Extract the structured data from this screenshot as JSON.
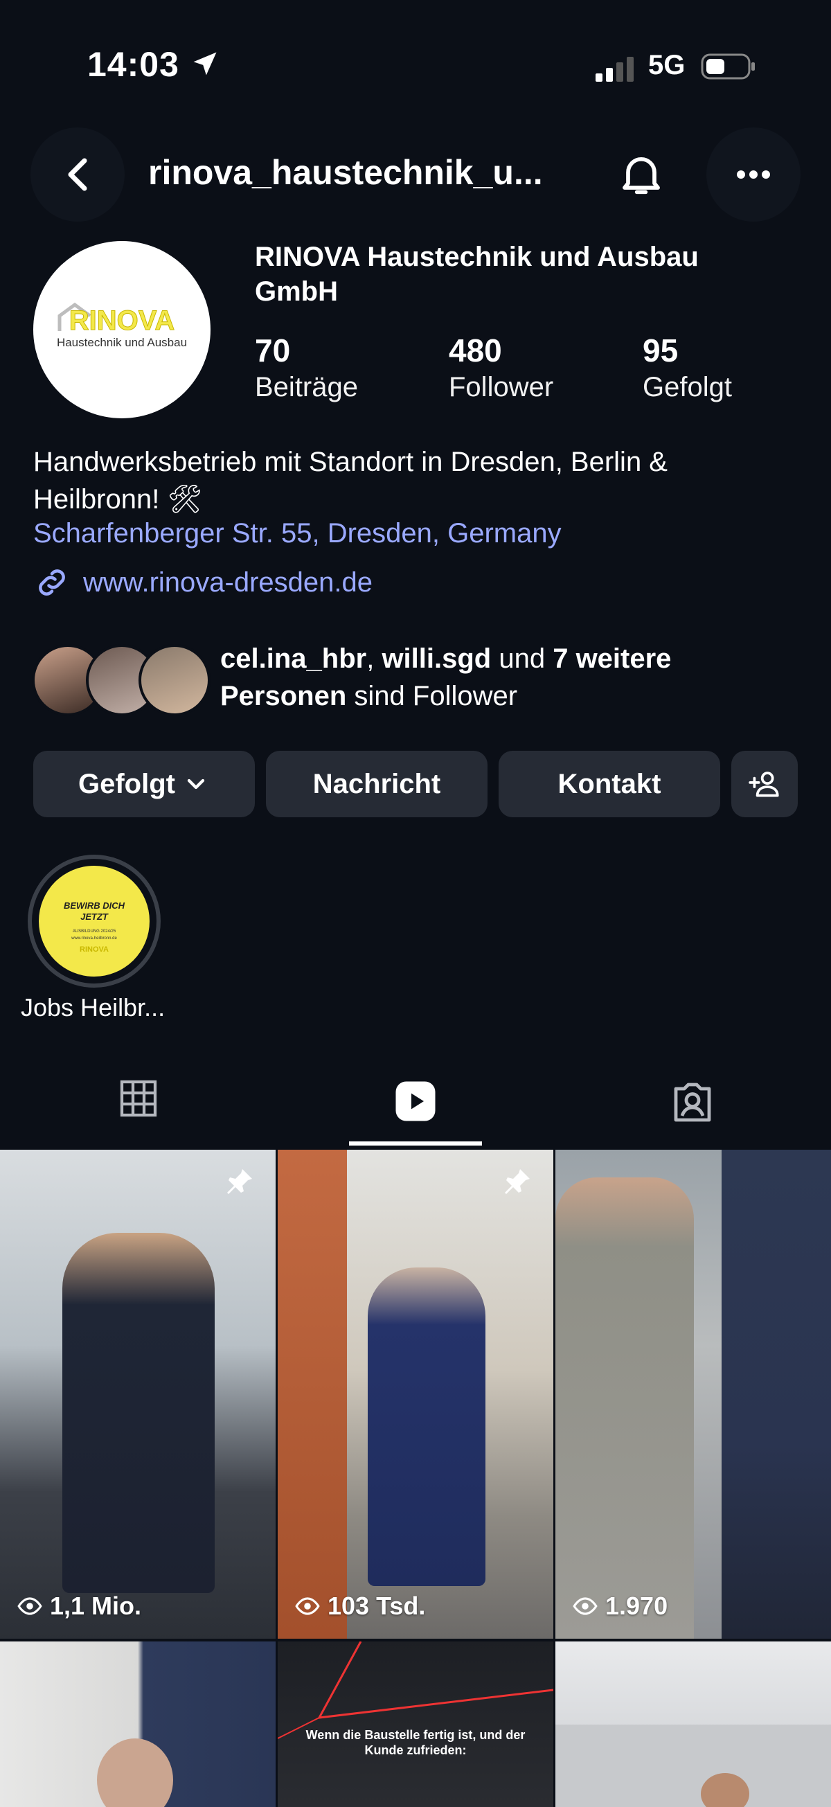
{
  "status_bar": {
    "time": "14:03",
    "network": "5G"
  },
  "header": {
    "handle": "rinova_haustechnik_u..."
  },
  "profile": {
    "logo_wordmark": "RINOVA",
    "logo_subtitle": "Haustechnik und Ausbau",
    "full_name": "RINOVA Haustechnik und Ausbau GmbH",
    "stats": [
      {
        "value": "70",
        "label": "Beiträge"
      },
      {
        "value": "480",
        "label": "Follower"
      },
      {
        "value": "95",
        "label": "Gefolgt"
      }
    ],
    "bio": "Handwerksbetrieb mit Standort in Dresden, Berlin & Heilbronn! 🛠",
    "location": "Scharfenberger Str. 55, Dresden, Germany",
    "website": "www.rinova-dresden.de"
  },
  "mutual_followers": {
    "name1": "cel.ina_hbr",
    "sep": ", ",
    "name2": "willi.sgd",
    "und": " und ",
    "more": "7 weitere Personen",
    "suffix": " sind Follower"
  },
  "actions": {
    "following_label": "Gefolgt",
    "message_label": "Nachricht",
    "contact_label": "Kontakt"
  },
  "highlights": [
    {
      "label": "Jobs Heilbr...",
      "cover_line1": "BEWIRB DICH",
      "cover_line2": "JETZT",
      "cover_small": "AUSBILDUNG 2024/25",
      "cover_url": "www.rinova-heilbronn.de",
      "cover_brand": "RINOVA"
    }
  ],
  "tabs": [
    "grid-tab",
    "reels-tab",
    "tagged-tab"
  ],
  "reels": [
    {
      "views": "1,1 Mio.",
      "pinned": true
    },
    {
      "views": "103 Tsd.",
      "pinned": true
    },
    {
      "views": "1.970",
      "pinned": false
    },
    {
      "views": "",
      "pinned": false
    },
    {
      "views": "",
      "pinned": false,
      "caption": "Wenn die Baustelle fertig ist, und der Kunde zufrieden:"
    },
    {
      "views": "",
      "pinned": false
    }
  ],
  "colors": {
    "background": "#0b0f17",
    "button": "#262b35",
    "link": "#9aa9ff",
    "logo_yellow": "#f3e84a"
  }
}
